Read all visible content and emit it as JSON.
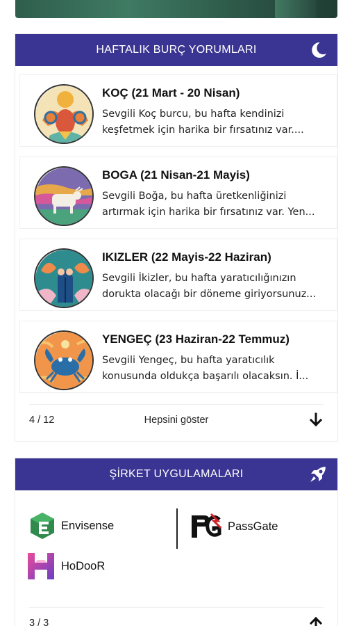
{
  "horoscope_panel": {
    "title": "HAFTALIK BURÇ YORUMLARI",
    "icon": "moon-icon",
    "items": [
      {
        "title": "KOÇ (21 Mart - 20 Nisan)",
        "line1": "Sevgili Koç burcu, bu hafta kendinizi",
        "line2": "keşfetmek için harika bir fırsatınız var....",
        "icon": "aries-avatar"
      },
      {
        "title": "BOGA (21 Nisan-21 Mayis)",
        "line1": "Sevgili Boğa, bu hafta üretkenliğinizi",
        "line2": "artırmak için harika bir fırsatınız var. Yen...",
        "icon": "taurus-avatar"
      },
      {
        "title": "IKIZLER (22 Mayis-22 Haziran)",
        "line1": "Sevgili İkizler, bu hafta yaratıcılığınızın",
        "line2": "dorukta olacağı bir döneme giriyorsunuz...",
        "icon": "gemini-avatar"
      },
      {
        "title": "YENGEÇ (23 Haziran-22 Temmuz)",
        "line1": "Sevgili Yengeç, bu hafta yaratıcılık",
        "line2": "konusunda oldukça başarılı olacaksın. İ...",
        "icon": "cancer-avatar"
      }
    ],
    "pager": {
      "count": "4 / 12",
      "show_all": "Hepsini göster",
      "arrow": "arrow-down-icon"
    }
  },
  "apps_panel": {
    "title": "ŞİRKET UYGULAMALARI",
    "icon": "rocket-icon",
    "apps": [
      {
        "name": "Envisense",
        "icon": "envisense-logo"
      },
      {
        "name": "PassGate",
        "icon": "passgate-logo"
      },
      {
        "name": "HoDooR",
        "icon": "hodoor-logo"
      }
    ],
    "pager": {
      "count": "3 / 3",
      "arrow": "arrow-up-icon"
    }
  },
  "colors": {
    "header": "#3a3592"
  }
}
